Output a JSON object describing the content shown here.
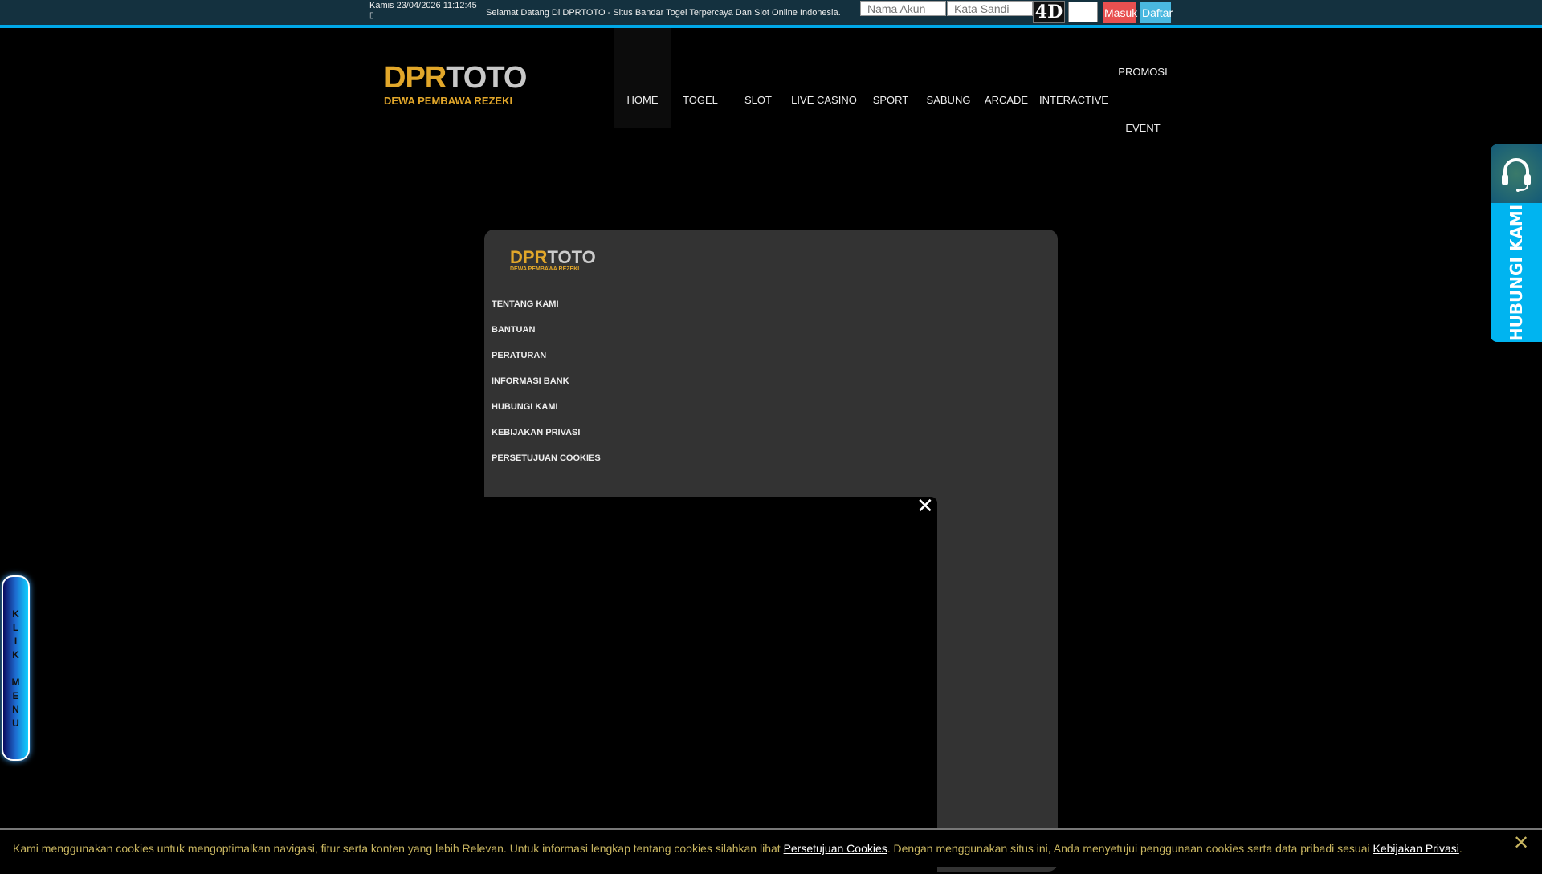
{
  "topbar": {
    "date": "Kamis 23/04/2026 11:12:45",
    "sub": "▯",
    "welcome": "Selamat Datang Di DPRTOTO - Situs Bandar Togel Terpercaya Dan Slot Online Indonesia.",
    "username_placeholder": "Nama Akun",
    "password_placeholder": "Kata Sandi",
    "captcha": "4D",
    "login": "Masuk",
    "register": "Daftar"
  },
  "logo": {
    "part1": "DPR",
    "part2": "TOTO",
    "tagline": "DEWA PEMBAWA REZEKI"
  },
  "nav": [
    "HOME",
    "TOGEL",
    "SLOT",
    "LIVE CASINO",
    "SPORT",
    "SABUNG",
    "ARCADE",
    "INTERACTIVE",
    "PROMOSI",
    "EVENT"
  ],
  "panel": {
    "items": [
      "TENTANG KAMI",
      "BANTUAN",
      "PERATURAN",
      "INFORMASI BANK",
      "HUBUNGI KAMI",
      "KEBIJAKAN PRIVASI",
      "PERSETUJUAN COOKIES"
    ],
    "close": "✕"
  },
  "contact": {
    "label": "HUBUNGI KAMI"
  },
  "klik_menu": [
    "K",
    "L",
    "I",
    "K",
    " ",
    "M",
    "E",
    "N",
    "U"
  ],
  "cookie": {
    "text1": "Kami menggunakan cookies untuk mengoptimalkan navigasi, fitur serta konten yang lebih Relevan. Untuk informasi lengkap tentang cookies silahkan lihat ",
    "link1": "Persetujuan Cookies",
    "text2": ". Dengan menggunakan situs ini, Anda menyetujui penggunaan cookies serta data pribadi sesuai ",
    "link2": "Kebijakan Privasi",
    "text3": ".",
    "close": "✕"
  },
  "colors": {
    "accent": "#00a8e8",
    "login": "#e85050",
    "register": "#4ab8e0",
    "gold": "#e2a72a"
  }
}
